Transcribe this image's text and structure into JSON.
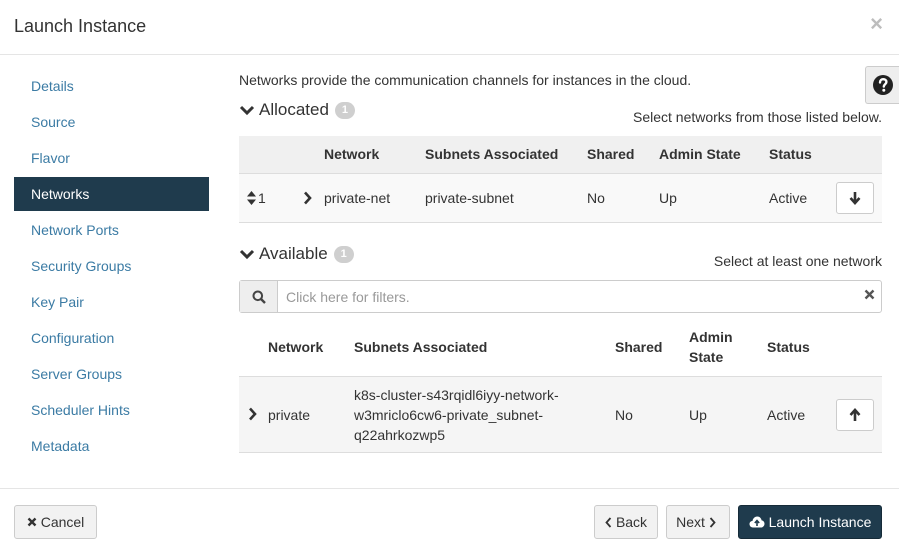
{
  "modal": {
    "title": "Launch Instance",
    "close_label": "×"
  },
  "sidebar": {
    "items": [
      {
        "label": "Details",
        "active": false
      },
      {
        "label": "Source",
        "active": false
      },
      {
        "label": "Flavor",
        "active": false
      },
      {
        "label": "Networks",
        "active": true
      },
      {
        "label": "Network Ports",
        "active": false
      },
      {
        "label": "Security Groups",
        "active": false
      },
      {
        "label": "Key Pair",
        "active": false
      },
      {
        "label": "Configuration",
        "active": false
      },
      {
        "label": "Server Groups",
        "active": false
      },
      {
        "label": "Scheduler Hints",
        "active": false
      },
      {
        "label": "Metadata",
        "active": false
      }
    ]
  },
  "networks": {
    "intro": "Networks provide the communication channels for instances in the cloud.",
    "allocated": {
      "title": "Allocated",
      "count": "1",
      "hint": "Select networks from those listed below.",
      "columns": [
        "Network",
        "Subnets Associated",
        "Shared",
        "Admin State",
        "Status"
      ],
      "rows": [
        {
          "order": "1",
          "network": "private-net",
          "subnets": "private-subnet",
          "shared": "No",
          "admin_state": "Up",
          "status": "Active"
        }
      ]
    },
    "available": {
      "title": "Available",
      "count": "1",
      "hint": "Select at least one network",
      "filter_placeholder": "Click here for filters.",
      "columns": [
        "Network",
        "Subnets Associated",
        "Shared",
        "Admin",
        "State",
        "Status"
      ],
      "rows": [
        {
          "network": "private",
          "subnets": [
            "k8s-cluster-s43rqidl6iyy-network-",
            "w3mriclo6cw6-private_subnet-",
            "q22ahrkozwp5"
          ],
          "shared": "No",
          "admin_state": "Up",
          "status": "Active"
        }
      ]
    }
  },
  "footer": {
    "cancel_label": "Cancel",
    "back_label": "Back",
    "next_label": "Next",
    "launch_label": "Launch Instance"
  },
  "colors": {
    "primary": "#1f3b4d",
    "link": "#3b7ba4",
    "badge": "#cfcfcf"
  },
  "icons": [
    "close-icon",
    "help-icon",
    "chevron-down-icon",
    "sort-icon",
    "chevron-right-icon",
    "arrow-down-icon",
    "arrow-up-icon",
    "search-icon",
    "clear-icon",
    "times-icon",
    "chevron-left-icon",
    "cloud-upload-icon"
  ]
}
